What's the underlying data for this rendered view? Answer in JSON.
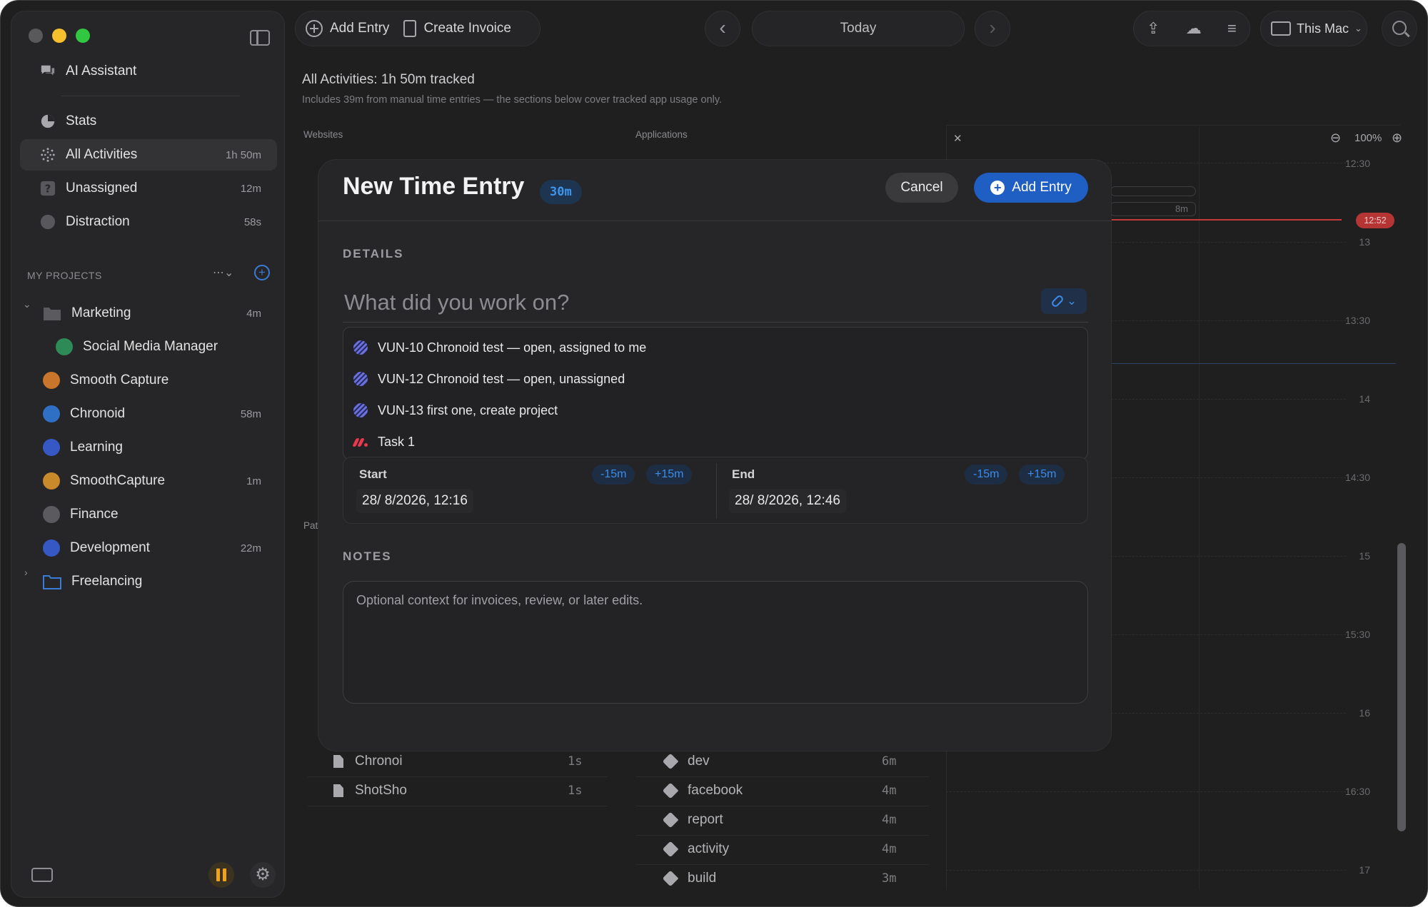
{
  "toolbar": {
    "add_entry": "Add Entry",
    "create_invoice": "Create Invoice",
    "today": "Today",
    "device": "This Mac"
  },
  "sidebar": {
    "top_items": [
      {
        "label": "AI Assistant",
        "count": ""
      },
      {
        "label": "Stats",
        "count": ""
      },
      {
        "label": "All Activities",
        "count": "1h 50m"
      },
      {
        "label": "Unassigned",
        "count": "12m"
      },
      {
        "label": "Distraction",
        "count": "58s"
      }
    ],
    "section_header": "MY PROJECTS",
    "projects": [
      {
        "label": "Marketing",
        "count": "4m",
        "color": "#5b5b5f"
      },
      {
        "label": "Social Media Manager",
        "count": "",
        "color": "#2e8b57"
      },
      {
        "label": "Smooth Capture",
        "count": "",
        "color": "#c9752c"
      },
      {
        "label": "Chronoid",
        "count": "58m",
        "color": "#2f6fc4"
      },
      {
        "label": "Learning",
        "count": "",
        "color": "#3558c4"
      },
      {
        "label": "SmoothCapture",
        "count": "1m",
        "color": "#c98a2c"
      },
      {
        "label": "Finance",
        "count": "",
        "color": "#5b5b5f"
      },
      {
        "label": "Development",
        "count": "22m",
        "color": "#3558c4"
      },
      {
        "label": "Freelancing",
        "count": "",
        "color": "#3a7bd5"
      }
    ]
  },
  "background": {
    "title": "All Activities: 1h 50m tracked",
    "subtitle": "Includes 39m from manual time entries — the sections below cover tracked app usage only.",
    "websites_label": "Websites",
    "applications_label": "Applications",
    "paths_label": "Pat",
    "files": [
      {
        "name": "Chronoi",
        "value": "1s"
      },
      {
        "name": "ShotSho",
        "value": "1s"
      }
    ],
    "tags": [
      {
        "name": "dev",
        "value": "6m"
      },
      {
        "name": "facebook",
        "value": "4m"
      },
      {
        "name": "report",
        "value": "4m"
      },
      {
        "name": "activity",
        "value": "4m"
      },
      {
        "name": "build",
        "value": "3m"
      }
    ],
    "timeline": {
      "zoom": "100%",
      "hours": [
        "12:30",
        "13",
        "13:30",
        "14",
        "14:30",
        "15",
        "15:30",
        "16",
        "16:30",
        "17"
      ],
      "bar_label": "8m",
      "now": "12:52"
    }
  },
  "modal": {
    "title": "New Time Entry",
    "duration": "30m",
    "cancel": "Cancel",
    "add_entry": "Add Entry",
    "details_label": "DETAILS",
    "work_placeholder": "What did you work on?",
    "suggestions": [
      {
        "label": "VUN-10 Chronoid test — open, assigned to me",
        "icon": "linear-icon"
      },
      {
        "label": "VUN-12 Chronoid test — open, unassigned",
        "icon": "linear-icon"
      },
      {
        "label": "VUN-13 first one, create project",
        "icon": "linear-icon"
      },
      {
        "label": "Task 1",
        "icon": "monday-icon"
      }
    ],
    "start_label": "Start",
    "end_label": "End",
    "minus_15": "-15m",
    "plus_15": "+15m",
    "start_value": "28/  8/2026, 12:16",
    "end_value": "28/  8/2026, 12:46",
    "notes_label": "NOTES",
    "notes_placeholder": "Optional context for invoices, review, or later edits."
  }
}
